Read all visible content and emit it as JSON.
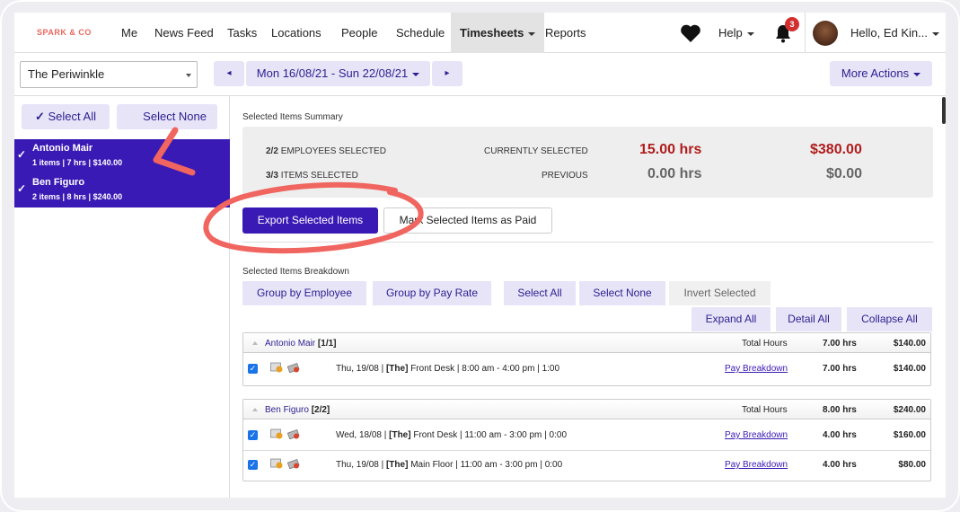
{
  "nav": {
    "logo": "SPARK & CO",
    "items": [
      "Me",
      "News Feed",
      "Tasks",
      "Locations",
      "People",
      "Schedule",
      "Timesheets",
      "Reports"
    ],
    "active": "Timesheets",
    "help": "Help",
    "notifications": "3",
    "user": "Hello, Ed Kin..."
  },
  "toolbar": {
    "location": "The Periwinkle",
    "prev": "◂",
    "date_range": "Mon 16/08/21 - Sun 22/08/21",
    "next": "▸",
    "more_actions": "More Actions"
  },
  "left": {
    "select_all": "Select All",
    "select_all_check": "✓",
    "select_none": "Select None",
    "employees": [
      {
        "name": "Antonio Mair",
        "meta": "1 items | 7 hrs | $140.00"
      },
      {
        "name": "Ben Figuro",
        "meta": "2 items | 8 hrs | $240.00"
      }
    ]
  },
  "summary": {
    "title": "Selected Items Summary",
    "employees_count": "2/2",
    "employees_label": "EMPLOYEES SELECTED",
    "items_count": "3/3",
    "items_label": "ITEMS SELECTED",
    "current_label": "CURRENTLY SELECTED",
    "current_hours": "15.00 hrs",
    "current_amount": "$380.00",
    "previous_label": "PREVIOUS",
    "previous_hours": "0.00 hrs",
    "previous_amount": "$0.00"
  },
  "actions": {
    "export": "Export Selected Items",
    "mark_paid": "Mark Selected Items as Paid"
  },
  "breakdown": {
    "title": "Selected Items Breakdown",
    "group_employee": "Group by Employee",
    "group_payrate": "Group by Pay Rate",
    "select_all": "Select All",
    "select_none": "Select None",
    "invert": "Invert Selected",
    "expand_all": "Expand All",
    "detail_all": "Detail All",
    "collapse_all": "Collapse All",
    "total_hours_label": "Total Hours",
    "pay_breakdown": "Pay Breakdown",
    "groups": [
      {
        "name": "Antonio Mair",
        "count": "[1/1]",
        "total_hours": "7.00 hrs",
        "total_amount": "$140.00",
        "rows": [
          {
            "date": "Thu, 19/08 | ",
            "loc": "[The]",
            "desc": " Front Desk | 8:00 am - 4:00 pm | 1:00",
            "hours": "7.00 hrs",
            "amount": "$140.00"
          }
        ]
      },
      {
        "name": "Ben Figuro",
        "count": "[2/2]",
        "total_hours": "8.00 hrs",
        "total_amount": "$240.00",
        "rows": [
          {
            "date": "Wed, 18/08 | ",
            "loc": "[The]",
            "desc": " Front Desk | 11:00 am - 3:00 pm | 0:00",
            "hours": "4.00 hrs",
            "amount": "$160.00"
          },
          {
            "date": "Thu, 19/08 | ",
            "loc": "[The]",
            "desc": " Main Floor | 11:00 am - 3:00 pm | 0:00",
            "hours": "4.00 hrs",
            "amount": "$80.00"
          }
        ]
      }
    ]
  },
  "colors": {
    "accent": "#3a1ab5",
    "button_light": "#e7e4f8",
    "money_red": "#b01c1c",
    "annotation": "#f0655f"
  }
}
